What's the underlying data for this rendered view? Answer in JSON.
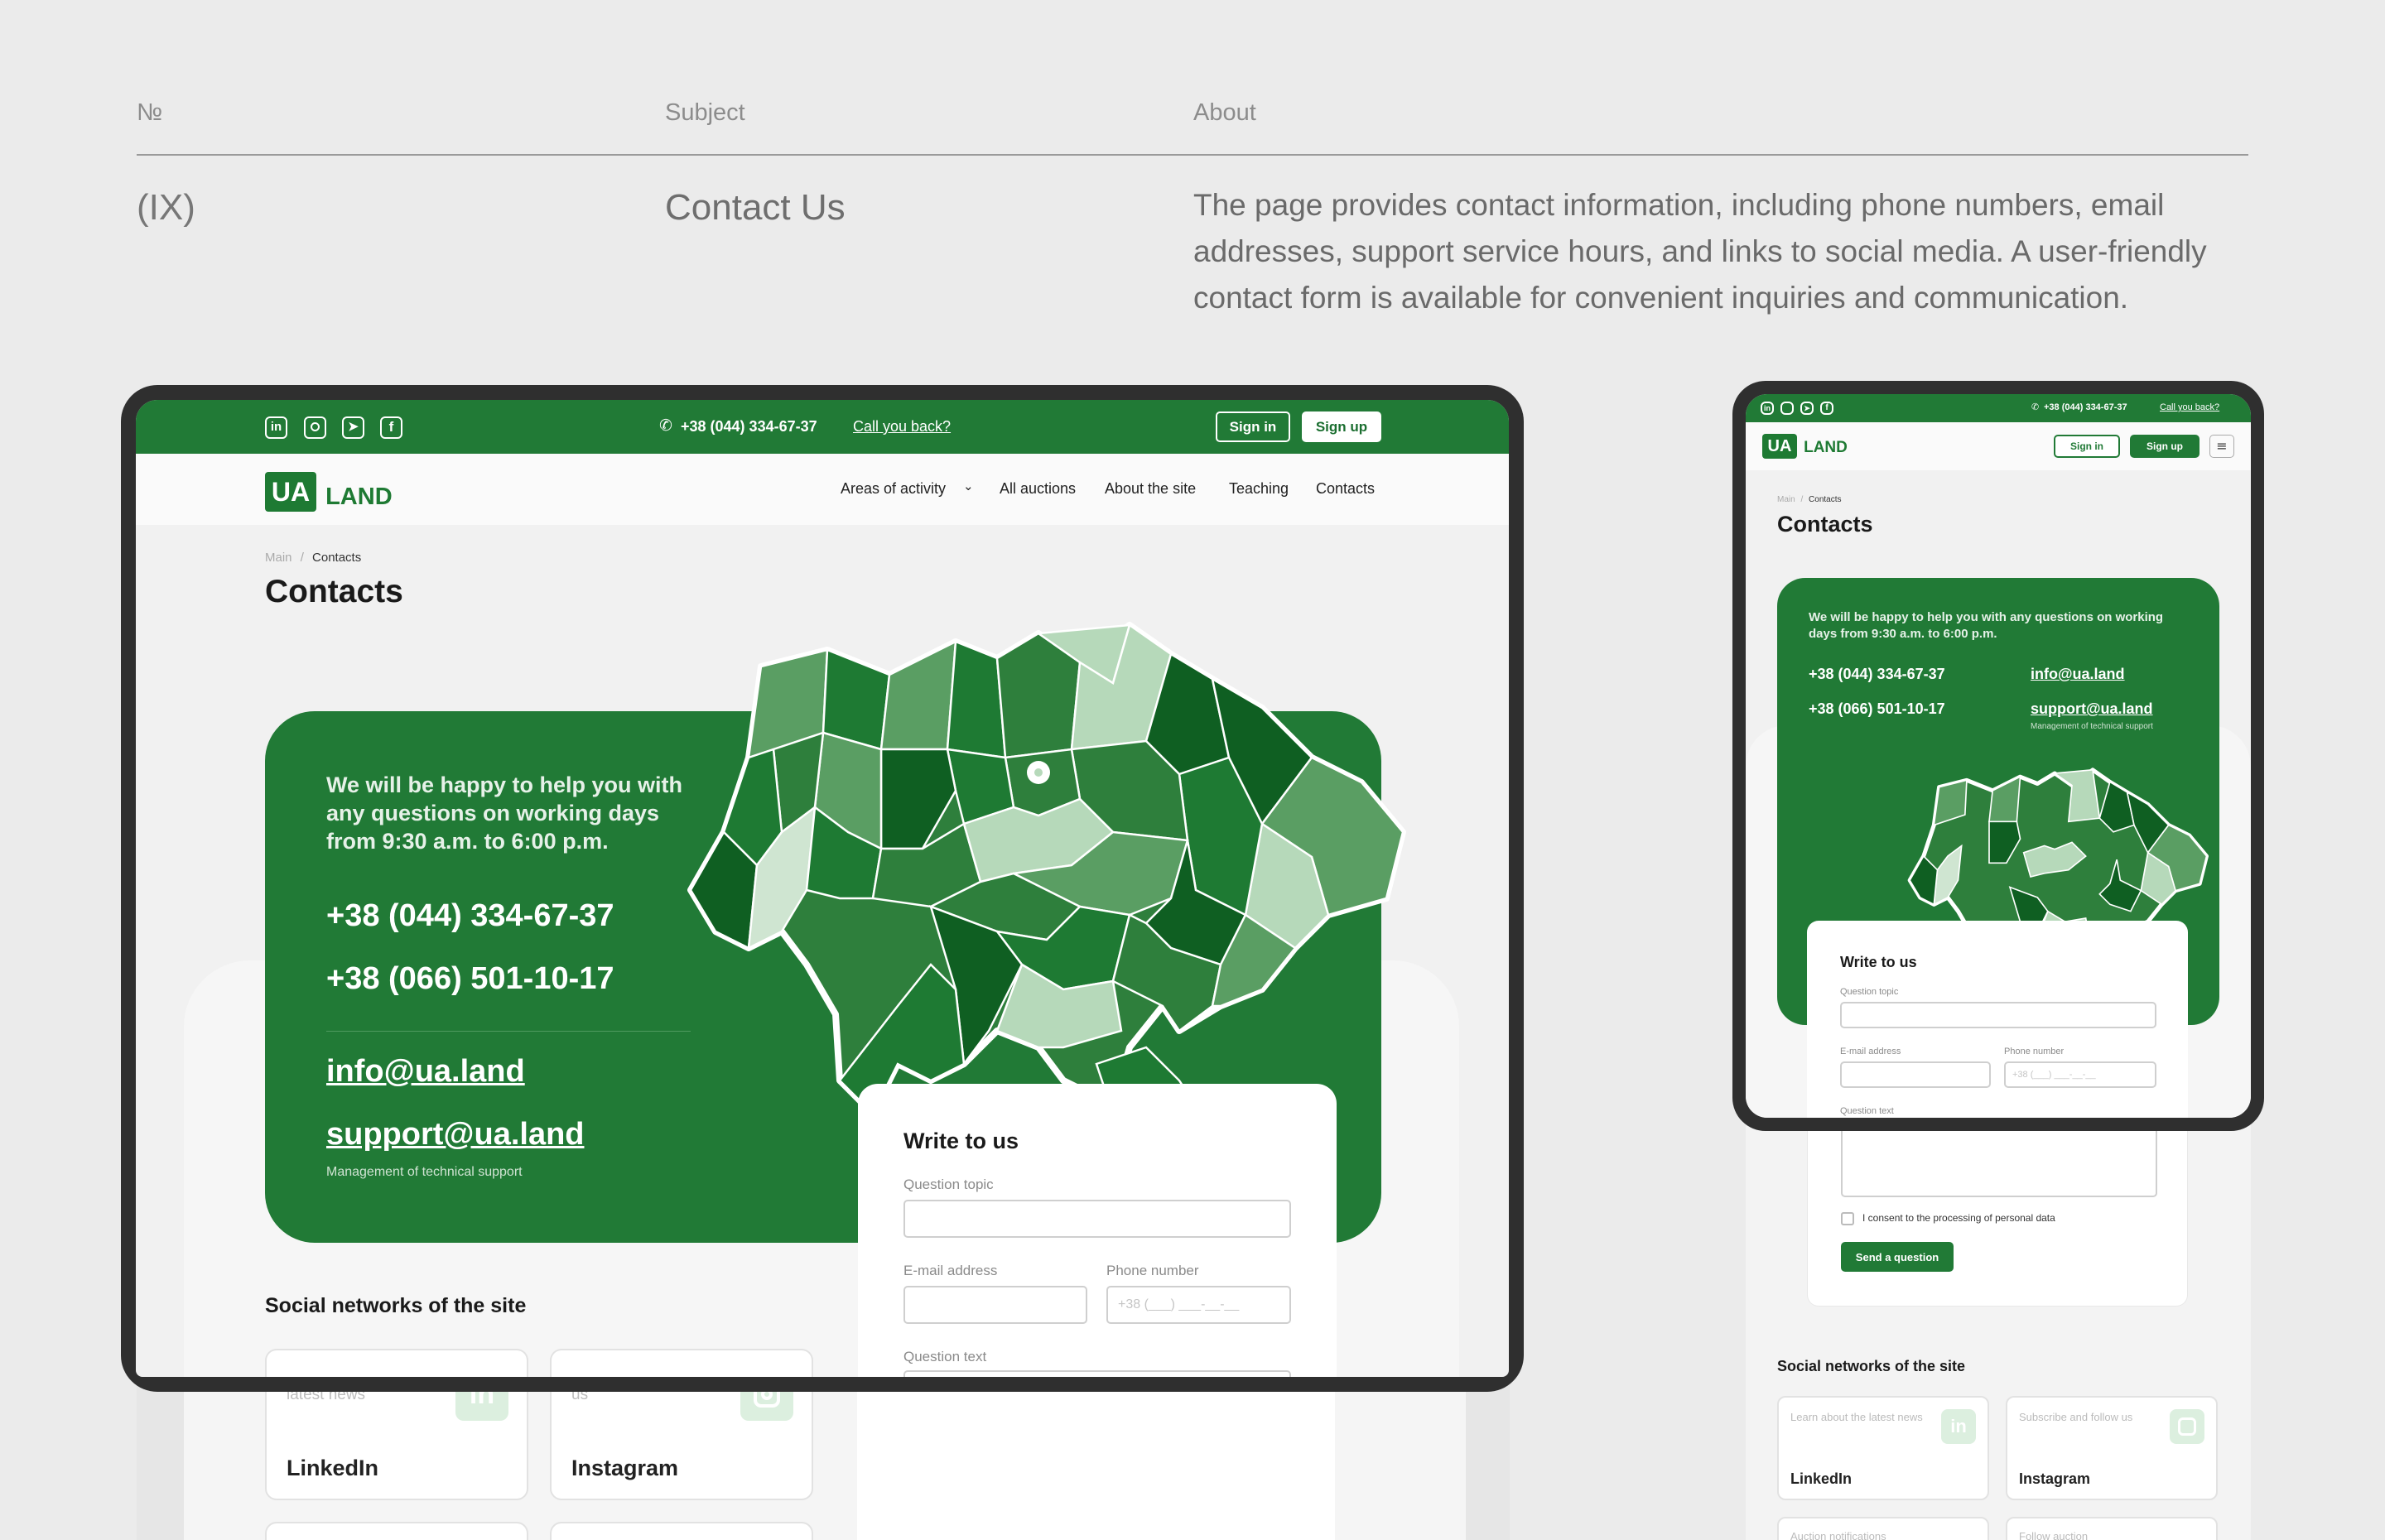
{
  "header": {
    "col_num": "№",
    "col_subject": "Subject",
    "col_about": "About",
    "number": "(IX)",
    "subject": "Contact Us",
    "about": "The page provides contact information, including phone numbers, email addresses, support service hours, and links to social media. A user-friendly contact form is available for convenient inquiries and communication."
  },
  "site": {
    "phone_top": "+38 (044) 334-67-37",
    "call_back": "Call you back?",
    "sign_in": "Sign in",
    "sign_up": "Sign up",
    "logo_ua": "UA",
    "logo_land": "LAND",
    "nav": [
      "Areas of activity",
      "All auctions",
      "About the site",
      "Teaching",
      "Contacts"
    ],
    "breadcrumb_main": "Main",
    "breadcrumb_sep": "/",
    "breadcrumb_current": "Contacts",
    "page_title": "Contacts",
    "help_text": "We will be happy to help you with any questions on working days from 9:30 a.m. to 6:00 p.m.",
    "phone_1": "+38 (044) 334-67-37",
    "phone_2": "+38 (066) 501-10-17",
    "email_1": "info@ua.land",
    "email_2": "support@ua.land",
    "email_2_note": "Management of technical support",
    "form": {
      "title": "Write to us",
      "topic_label": "Question topic",
      "email_label": "E-mail address",
      "phone_label": "Phone number",
      "phone_placeholder": "+38 (___) ___-__-__",
      "text_label": "Question text",
      "consent": "I consent to the processing of personal data",
      "submit": "Send a question"
    },
    "social_title": "Social networks of the site",
    "social_cards": [
      {
        "caption_desktop": "Learn about the latest news",
        "caption_tablet": "Learn about the latest news",
        "name": "LinkedIn",
        "icon": "linkedin-icon"
      },
      {
        "caption_desktop": "Subscribe and follow us",
        "caption_tablet": "Subscribe and follow us",
        "name": "Instagram",
        "icon": "instagram-icon"
      },
      {
        "caption_tablet": "Auction notifications",
        "icon": "telegram-icon"
      },
      {
        "caption_tablet": "Follow auction",
        "icon": "facebook-icon"
      }
    ]
  },
  "colors": {
    "brand_green": "#217a36",
    "page_bg": "#ebebeb",
    "map_light": "#b6d9ba",
    "map_mid": "#5a9e63",
    "map_dark": "#0f5f22"
  }
}
